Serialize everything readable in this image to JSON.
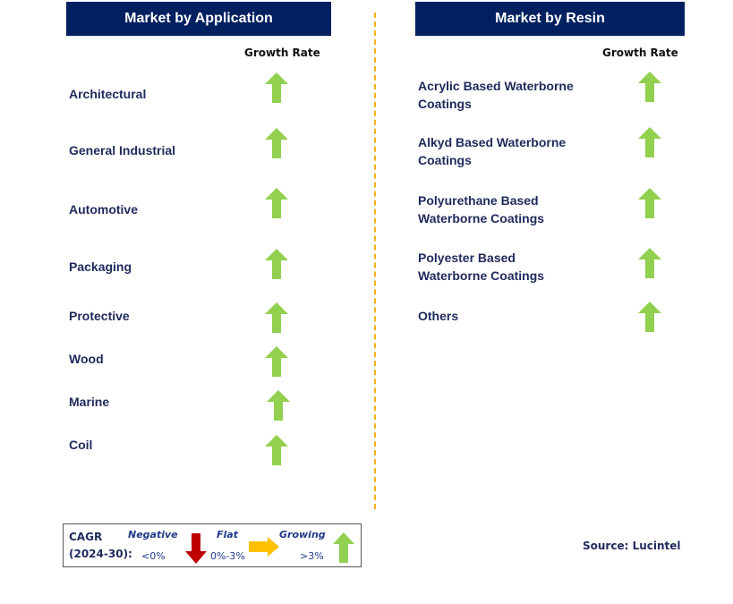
{
  "application": {
    "title": "Market by Application",
    "growth_rate_label": "Growth Rate",
    "items": [
      {
        "label": "Architectural",
        "trend": "growing"
      },
      {
        "label": "General Industrial",
        "trend": "growing"
      },
      {
        "label": "Automotive",
        "trend": "growing"
      },
      {
        "label": "Packaging",
        "trend": "growing"
      },
      {
        "label": "Protective",
        "trend": "growing"
      },
      {
        "label": "Wood",
        "trend": "growing"
      },
      {
        "label": "Marine",
        "trend": "growing"
      },
      {
        "label": "Coil",
        "trend": "growing"
      }
    ]
  },
  "resin": {
    "title": "Market by Resin",
    "growth_rate_label": "Growth Rate",
    "items": [
      {
        "line1": "Acrylic Based Waterborne",
        "line2": "Coatings",
        "trend": "growing"
      },
      {
        "line1": "Alkyd Based Waterborne",
        "line2": "Coatings",
        "trend": "growing"
      },
      {
        "line1": "Polyurethane Based",
        "line2": "Waterborne Coatings",
        "trend": "growing"
      },
      {
        "line1": "Polyester Based",
        "line2": "Waterborne Coatings",
        "trend": "growing"
      },
      {
        "line1": "Others",
        "line2": "",
        "trend": "growing"
      }
    ]
  },
  "legend": {
    "cagr_label": "CAGR",
    "period": "(2024-30):",
    "negative": {
      "label": "Negative",
      "range": "<0%",
      "icon": "down-arrow-icon"
    },
    "flat": {
      "label": "Flat",
      "range": "0%-3%",
      "icon": "right-arrow-icon"
    },
    "growing": {
      "label": "Growing",
      "range": ">3%",
      "icon": "up-arrow-icon"
    }
  },
  "colors": {
    "header_bg": "#002060",
    "growing": "#92d050",
    "flat": "#ffc000",
    "negative": "#c00000",
    "divider": "#f5b21b"
  },
  "source": "Source: Lucintel"
}
